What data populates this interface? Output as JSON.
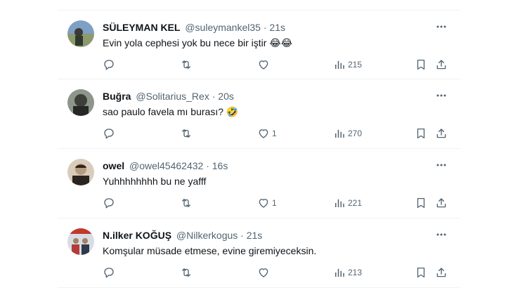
{
  "tweets": [
    {
      "name": "SÜLEYMAN KEL",
      "handle": "@suleymankel35",
      "sep": "·",
      "time": "21s",
      "text": "Evin yola cephesi yok  bu nece bir iştir",
      "emoji": "😂😂",
      "likes": "",
      "views": "215",
      "avatar_colors": [
        "#5b7fa6",
        "#a7b78a"
      ]
    },
    {
      "name": "Buğra",
      "handle": "@Solitarius_Rex",
      "sep": "·",
      "time": "20s",
      "text": "sao paulo favela mı burası?",
      "emoji": "🤣",
      "likes": "1",
      "views": "270",
      "avatar_colors": [
        "#3a3d38",
        "#9da596"
      ]
    },
    {
      "name": "owel",
      "handle": "@owel45462432",
      "sep": "·",
      "time": "16s",
      "text": "Yuhhhhhhhh bu ne yafff",
      "emoji": "",
      "likes": "1",
      "views": "221",
      "avatar_colors": [
        "#2a2420",
        "#c9b6a0"
      ]
    },
    {
      "name": "N.ilker KOĞUŞ",
      "handle": "@Nilkerkogus",
      "sep": "·",
      "time": "21s",
      "text": "Komşular müsade etmese, evine giremiyeceksin.",
      "emoji": "",
      "likes": "",
      "views": "213",
      "avatar_colors": [
        "#b23a3a",
        "#d8dde4"
      ]
    }
  ],
  "icons": {
    "more": "more-icon",
    "reply": "reply-icon",
    "retweet": "retweet-icon",
    "like": "like-icon",
    "views": "views-icon",
    "bookmark": "bookmark-icon",
    "share": "share-icon"
  },
  "colors": {
    "text_primary": "#0f1419",
    "text_secondary": "#536471",
    "border": "#eff3f4"
  }
}
